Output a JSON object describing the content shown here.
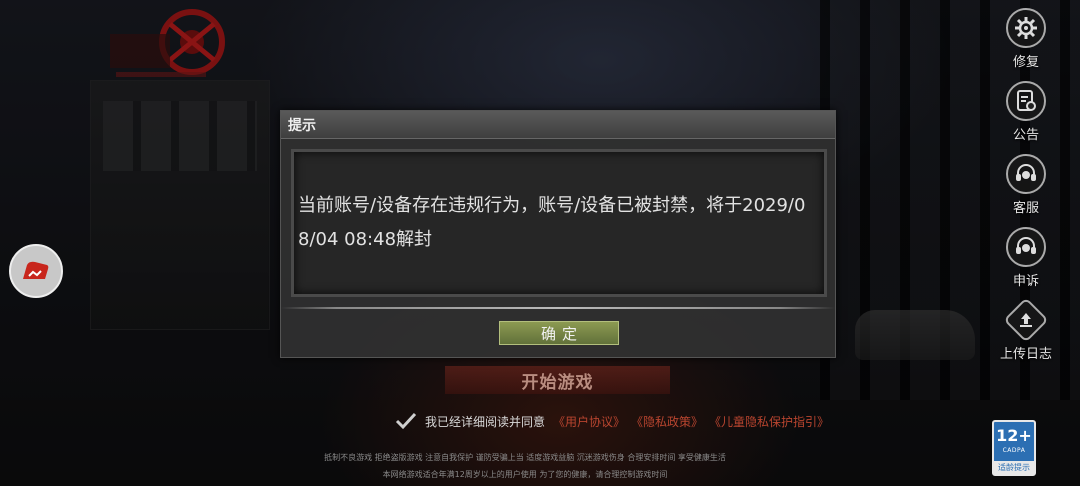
{
  "side_menu": {
    "items": [
      {
        "label": "修复",
        "icon": "gear-icon"
      },
      {
        "label": "公告",
        "icon": "notice-icon"
      },
      {
        "label": "客服",
        "icon": "headset-icon"
      },
      {
        "label": "申诉",
        "icon": "headset-icon"
      },
      {
        "label": "上传日志",
        "icon": "upload-icon"
      }
    ]
  },
  "start": {
    "label": "开始游戏"
  },
  "agreement": {
    "prefix": "我已经详细阅读并同意",
    "links": [
      "《用户协议》",
      "《隐私政策》",
      "《儿童隐私保护指引》"
    ]
  },
  "footer": {
    "line1": "抵制不良游戏 拒绝盗版游戏 注意自我保护 谨防受骗上当 适度游戏益脑 沉迷游戏伤身 合理安排时间 享受健康生活",
    "line2": "本网络游戏适合年满12周岁以上的用户使用  为了您的健康，请合理控制游戏时间"
  },
  "age_rating": {
    "value": "12+",
    "brand": "CADPA",
    "caption": "适龄提示"
  },
  "dialog": {
    "title": "提示",
    "message": "当前账号/设备存在违规行为，账号/设备已被封禁，将于2029/08/04 08:48解封",
    "confirm_label": "确定"
  },
  "colors": {
    "link": "#b9452f",
    "confirm": "#7a8a45",
    "age_badge": "#2c6fb3"
  }
}
